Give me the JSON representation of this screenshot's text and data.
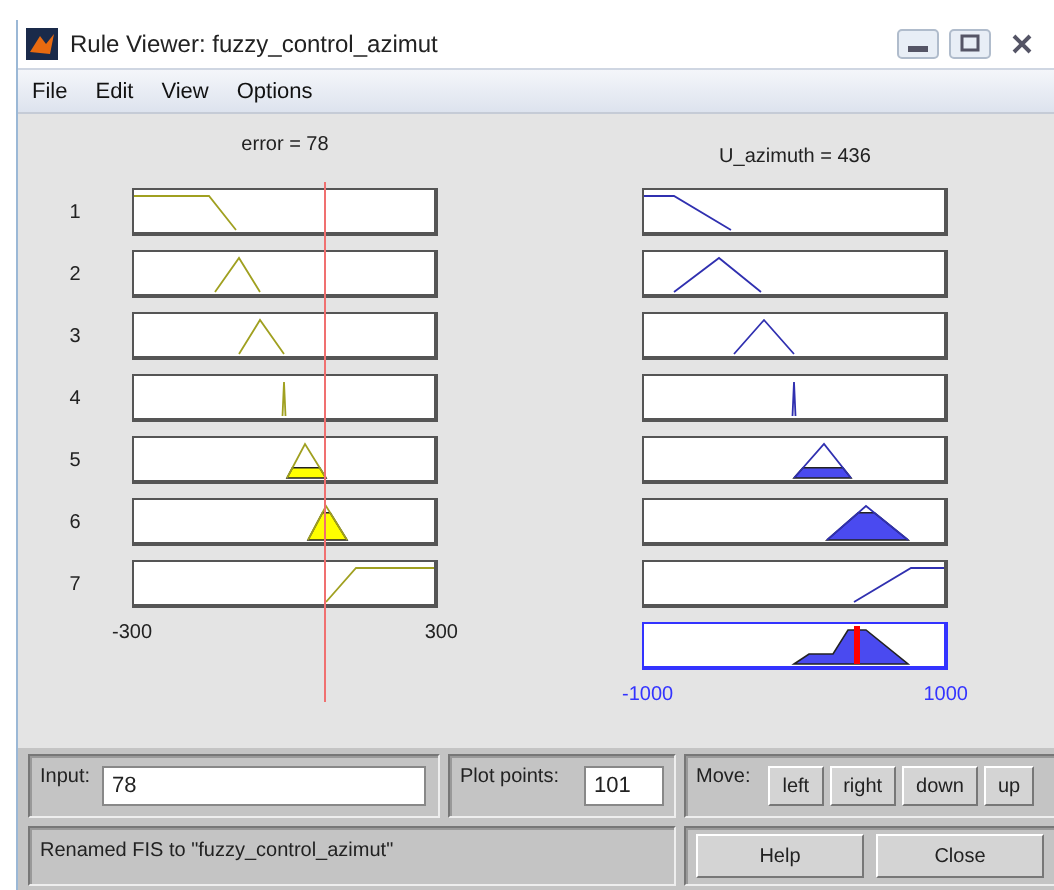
{
  "window": {
    "title": "Rule Viewer: fuzzy_control_azimut"
  },
  "menu": [
    "File",
    "Edit",
    "View",
    "Options"
  ],
  "input_variable": {
    "label": "error = 78",
    "min": "-300",
    "max": "300"
  },
  "output_variable": {
    "label": "U_azimuth = 436",
    "min": "-1000",
    "max": "1000"
  },
  "rules": [
    "1",
    "2",
    "3",
    "4",
    "5",
    "6",
    "7"
  ],
  "input": {
    "label": "Input:",
    "value": "78"
  },
  "plot_points": {
    "label": "Plot points:",
    "value": "101"
  },
  "move": {
    "label": "Move:",
    "buttons": [
      "left",
      "right",
      "down",
      "up"
    ]
  },
  "status": "Renamed FIS to \"fuzzy_control_azimut\"",
  "buttons": [
    "Help",
    "Close"
  ]
}
